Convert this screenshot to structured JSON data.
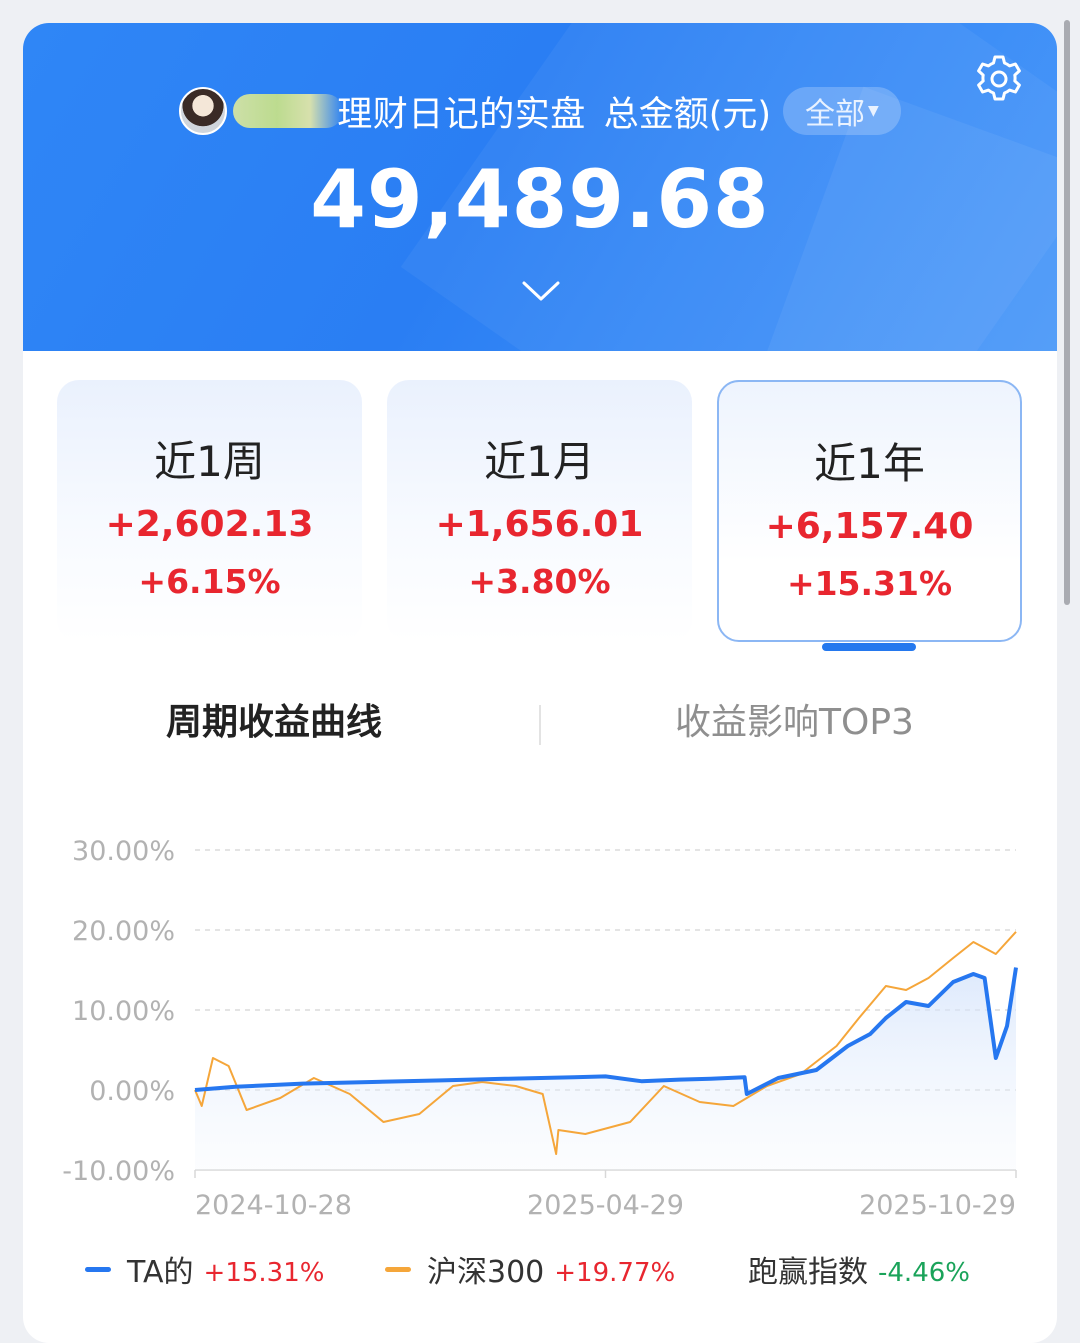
{
  "header": {
    "account_name": "理财日记的实盘",
    "total_label": "总金额(元)",
    "filter_label": "全部",
    "total_value": "49,489.68",
    "settings_icon": "gear-icon",
    "expand_icon": "chevron-down-icon"
  },
  "periods": [
    {
      "label": "近1周",
      "amount": "+2,602.13",
      "percent": "+6.15%"
    },
    {
      "label": "近1月",
      "amount": "+1,656.01",
      "percent": "+3.80%"
    },
    {
      "label": "近1年",
      "amount": "+6,157.40",
      "percent": "+15.31%"
    }
  ],
  "active_period": "近1年",
  "section_tabs": {
    "curve": "周期收益曲线",
    "top3": "收益影响TOP3"
  },
  "colors": {
    "brand_blue": "#2f86f6",
    "positive_red": "#e8262f",
    "negative_green": "#1aa35a",
    "series_ta": "#2677f0",
    "series_index": "#f5a63a"
  },
  "chart_data": {
    "type": "line",
    "y_ticks": [
      "30.00%",
      "20.00%",
      "10.00%",
      "0.00%",
      "-10.00%"
    ],
    "x_ticks": [
      "2024-10-28",
      "2025-04-29",
      "2025-10-29"
    ],
    "ylim": [
      -10,
      30
    ],
    "xlim": [
      "2024-10-28",
      "2025-10-29"
    ],
    "grid": true,
    "legend_position": "bottom",
    "series": [
      {
        "name": "TA的",
        "x": [
          "2024-10-28",
          "2024-11-15",
          "2024-12-15",
          "2025-01-15",
          "2025-02-15",
          "2025-03-15",
          "2025-04-15",
          "2025-04-29",
          "2025-05-15",
          "2025-06-01",
          "2025-06-15",
          "2025-06-30",
          "2025-07-01",
          "2025-07-15",
          "2025-08-01",
          "2025-08-15",
          "2025-08-25",
          "2025-09-01",
          "2025-09-10",
          "2025-09-20",
          "2025-10-01",
          "2025-10-10",
          "2025-10-15",
          "2025-10-20",
          "2025-10-25",
          "2025-10-29"
        ],
        "values": [
          0.0,
          0.4,
          0.8,
          1.0,
          1.2,
          1.4,
          1.6,
          1.7,
          1.1,
          1.3,
          1.4,
          1.6,
          -0.5,
          1.5,
          2.5,
          5.5,
          7.0,
          9.0,
          11.0,
          10.5,
          13.5,
          14.5,
          14.0,
          4.0,
          8.0,
          15.31
        ]
      },
      {
        "name": "沪深300",
        "x": [
          "2024-10-28",
          "2024-10-31",
          "2024-11-05",
          "2024-11-12",
          "2024-11-20",
          "2024-12-05",
          "2024-12-20",
          "2025-01-05",
          "2025-01-20",
          "2025-02-05",
          "2025-02-20",
          "2025-03-05",
          "2025-03-20",
          "2025-04-01",
          "2025-04-07",
          "2025-04-08",
          "2025-04-20",
          "2025-05-10",
          "2025-05-25",
          "2025-06-10",
          "2025-06-25",
          "2025-07-10",
          "2025-07-25",
          "2025-08-10",
          "2025-08-20",
          "2025-09-01",
          "2025-09-10",
          "2025-09-20",
          "2025-10-01",
          "2025-10-10",
          "2025-10-20",
          "2025-10-29"
        ],
        "values": [
          0.0,
          -2.0,
          4.0,
          3.0,
          -2.5,
          -1.0,
          1.5,
          -0.5,
          -4.0,
          -3.0,
          0.5,
          1.0,
          0.5,
          -0.5,
          -8.0,
          -5.0,
          -5.5,
          -4.0,
          0.5,
          -1.5,
          -2.0,
          0.5,
          2.0,
          5.5,
          9.0,
          13.0,
          12.5,
          14.0,
          16.5,
          18.5,
          17.0,
          19.77
        ]
      }
    ]
  },
  "legend": [
    {
      "name": "TA的",
      "value": "+15.31%"
    },
    {
      "name": "沪深300",
      "value": "+19.77%"
    },
    {
      "name": "跑赢指数",
      "value": "-4.46%"
    }
  ]
}
